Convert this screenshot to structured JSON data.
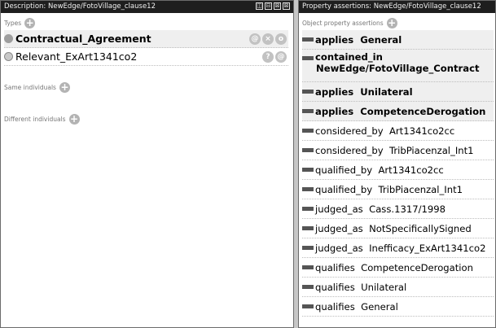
{
  "description_pane": {
    "title": "Description: NewEdge/FotoVillage_clause12",
    "window_controls": [
      "◫",
      "⊟",
      "⊠",
      "⊠"
    ],
    "types": {
      "header": "Types",
      "items": [
        {
          "label": "Contractual_Agreement",
          "actions": [
            "@",
            "×",
            "o"
          ]
        },
        {
          "label": "Relevant_ExArt1341co2",
          "actions": [
            "?",
            "@"
          ]
        }
      ]
    },
    "same_individuals": {
      "header": "Same individuals"
    },
    "different_individuals": {
      "header": "Different individuals"
    }
  },
  "property_pane": {
    "title": "Property assertions: NewEdge/FotoVillage_clause12",
    "object_property_header": "Object property assertions",
    "assertions": [
      {
        "property": "applies",
        "value": "General"
      },
      {
        "property": "contained_in",
        "value": "NewEdge/FotoVillage_Contract"
      },
      {
        "property": "applies",
        "value": "Unilateral"
      },
      {
        "property": "applies",
        "value": "CompetenceDerogation"
      },
      {
        "property": "considered_by",
        "value": "Art1341co2cc"
      },
      {
        "property": "considered_by",
        "value": "TribPiacenzal_Int1"
      },
      {
        "property": "qualified_by",
        "value": "Art1341co2cc"
      },
      {
        "property": "qualified_by",
        "value": "TribPiacenzal_Int1"
      },
      {
        "property": "judged_as",
        "value": "Cass.1317/1998"
      },
      {
        "property": "judged_as",
        "value": "NotSpecificallySigned"
      },
      {
        "property": "judged_as",
        "value": "Inefficacy_ExArt1341co2"
      },
      {
        "property": "qualifies",
        "value": "CompetenceDerogation"
      },
      {
        "property": "qualifies",
        "value": "Unilateral"
      },
      {
        "property": "qualifies",
        "value": "General"
      }
    ]
  },
  "colors": {
    "titlebar": "#1e1e1e",
    "highlight_row": "#efefef",
    "add_button": "#b3b3b3",
    "property_bar": "#555555"
  }
}
